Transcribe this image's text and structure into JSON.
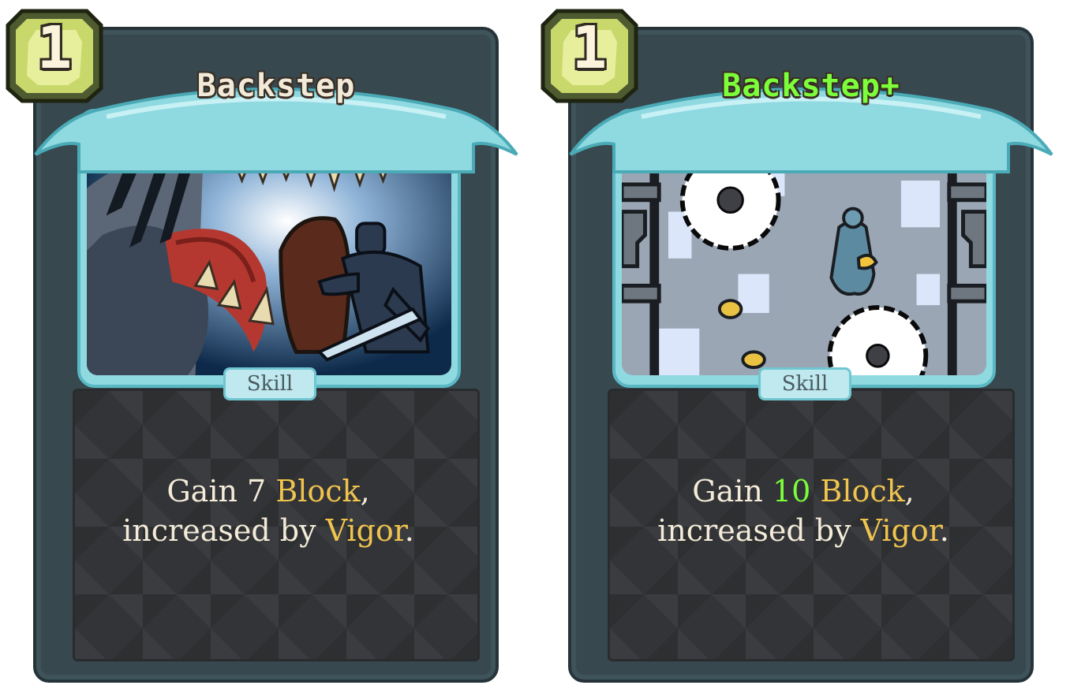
{
  "cards": [
    {
      "name": "Backstep",
      "cost": "1",
      "type": "Skill",
      "upgraded": false,
      "description": {
        "line1_prefix": "Gain ",
        "block_amount": "7",
        "block_keyword": "Block",
        "line1_suffix": ",",
        "line2_prefix": "increased by ",
        "vigor_keyword": "Vigor",
        "line2_suffix": "."
      },
      "art": "monster-maw-knight-art"
    },
    {
      "name": "Backstep+",
      "cost": "1",
      "type": "Skill",
      "upgraded": true,
      "description": {
        "line1_prefix": "Gain ",
        "block_amount": "10",
        "block_keyword": "Block",
        "line1_suffix": ",",
        "line2_prefix": "increased by ",
        "vigor_keyword": "Vigor",
        "line2_suffix": "."
      },
      "art": "sawblade-corridor-art"
    }
  ],
  "colors": {
    "frame": "#37484f",
    "banner": "#8fd9e0",
    "keyword": "#efc34e",
    "upgrade_green": "#7cff3a",
    "text": "#f4ecd9",
    "energy_orb": "#c9d86a"
  }
}
